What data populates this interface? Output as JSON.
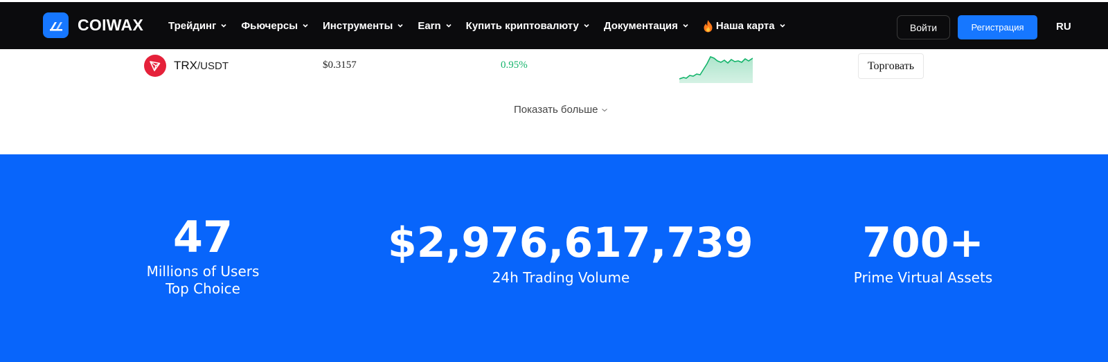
{
  "brand": {
    "name": "COIWAX",
    "accent": "#1677ff"
  },
  "nav": {
    "items": [
      {
        "label": "Трейдинг"
      },
      {
        "label": "Фьючерсы"
      },
      {
        "label": "Инструменты"
      },
      {
        "label": "Earn"
      },
      {
        "label": "Купить криптовалюту"
      },
      {
        "label": "Документация"
      },
      {
        "label": "Наша карта",
        "icon": "fire-icon"
      }
    ],
    "login_label": "Войти",
    "register_label": "Регистрация",
    "language": "RU"
  },
  "market_row": {
    "base": "TRX",
    "quote": "/USDT",
    "price": "$0.3157",
    "change": "0.95%",
    "change_color": "#14b46b",
    "icon": "tron-icon",
    "trade_label": "Торговать"
  },
  "show_more_label": "Показать больше",
  "stats": {
    "background": "#0865fb",
    "users": {
      "value": "47",
      "label": "Millions of Users Top Choice"
    },
    "volume": {
      "value": "$2,976,617,739",
      "label": "24h Trading Volume"
    },
    "assets": {
      "value": "700+",
      "label": "Prime Virtual Assets"
    }
  }
}
